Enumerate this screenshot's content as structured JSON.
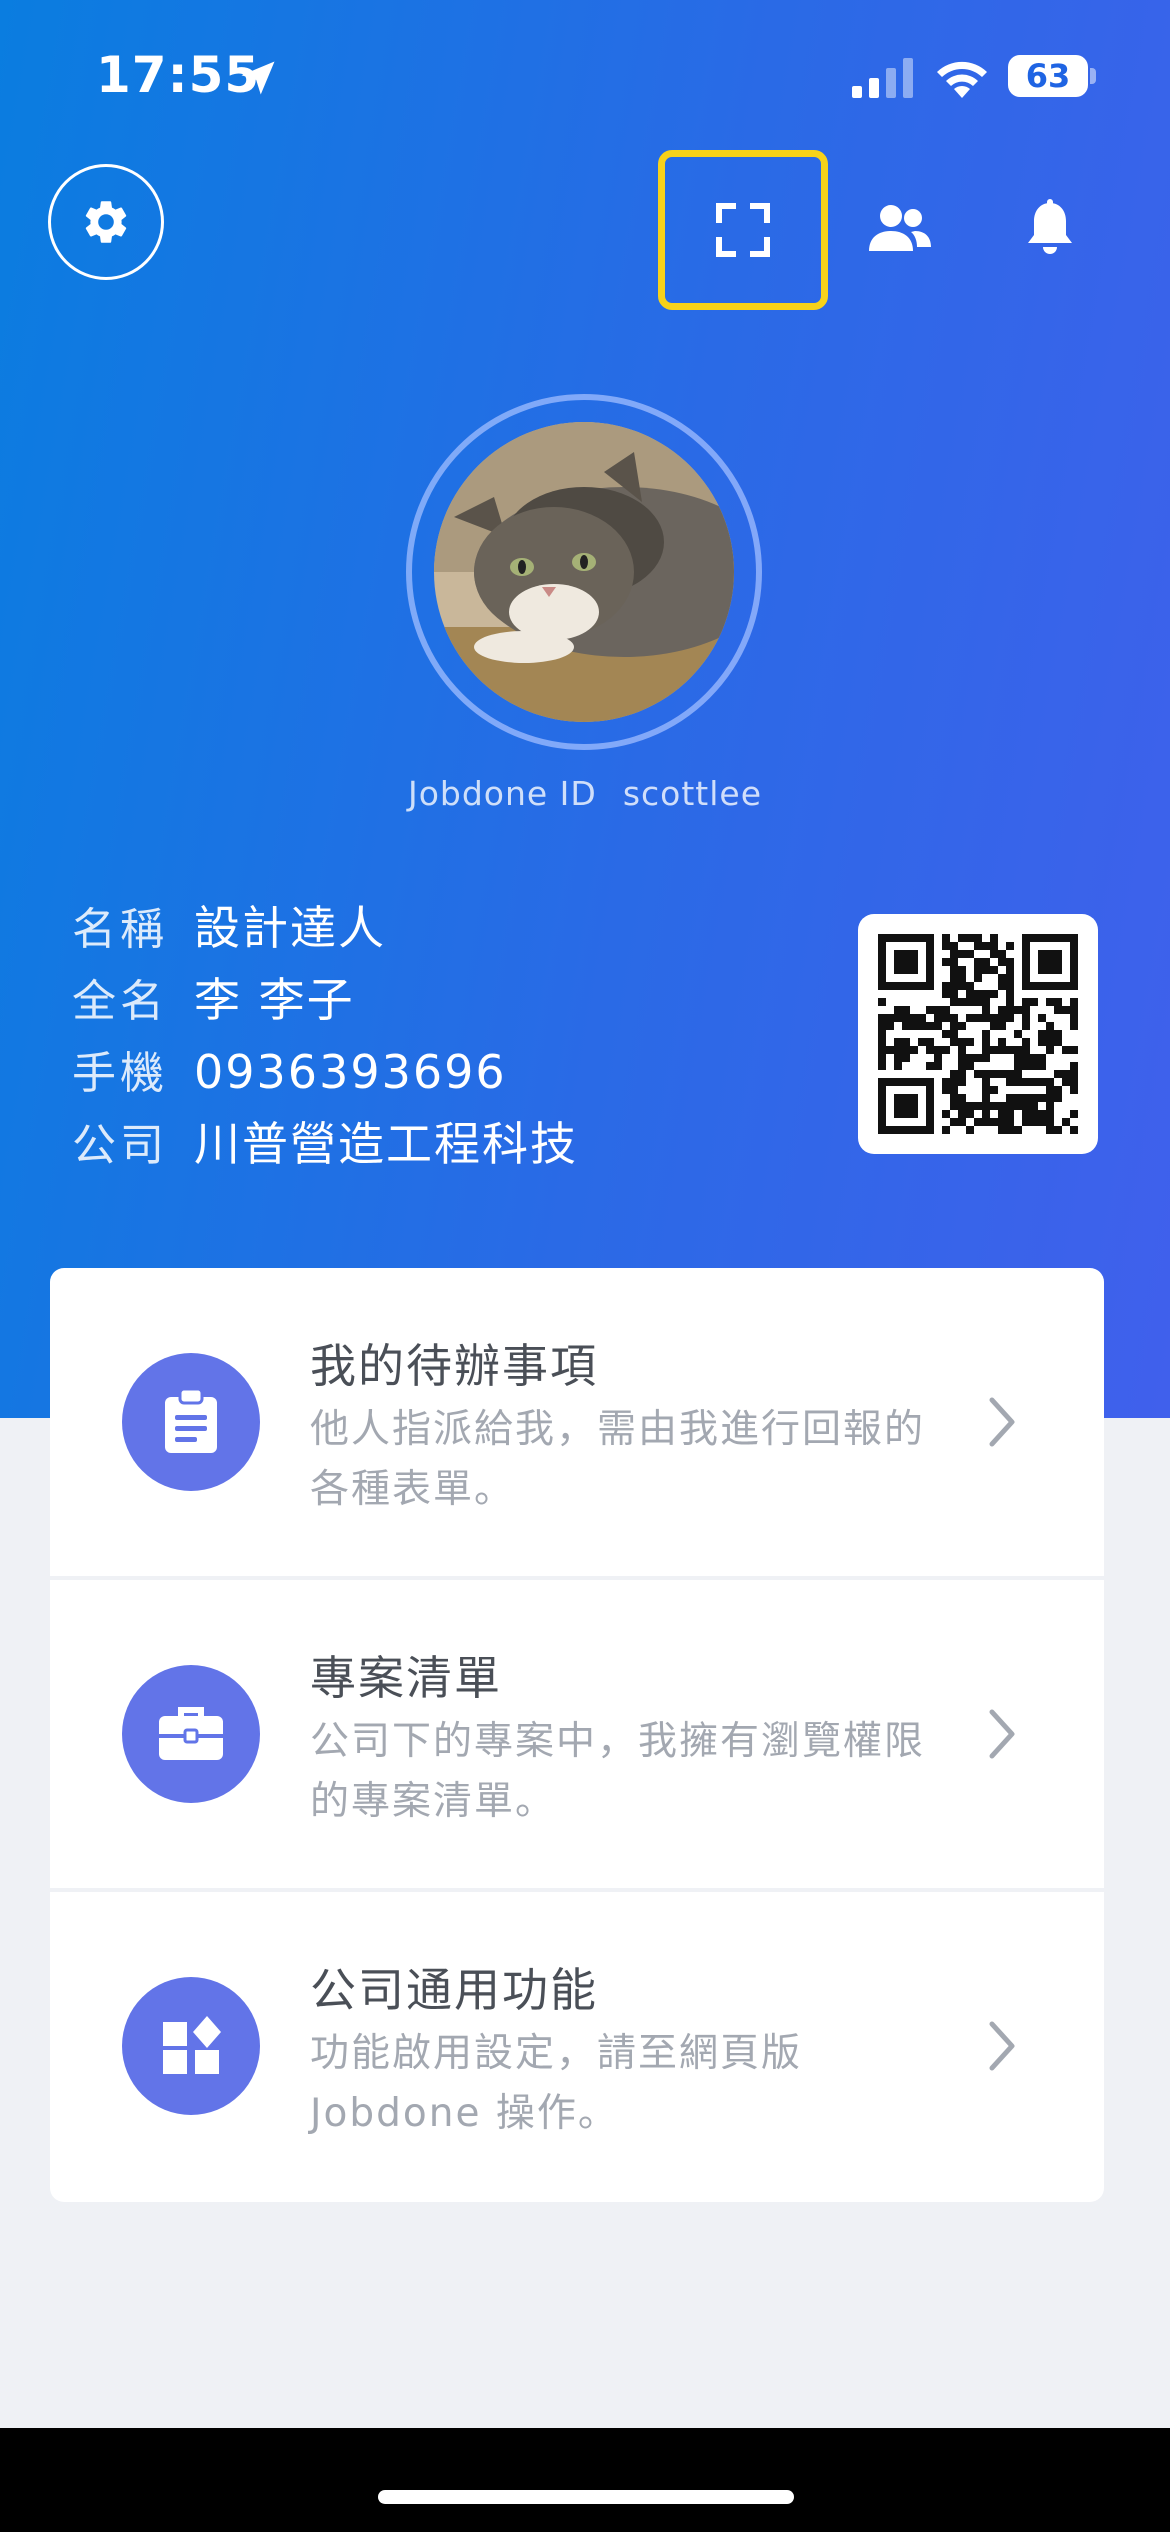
{
  "status_bar": {
    "time": "17:55",
    "battery": "63",
    "icons": [
      "location-arrow-icon",
      "signal-icon",
      "wifi-icon",
      "battery-icon"
    ]
  },
  "header": {
    "icons": [
      "gear-icon",
      "scan-frame-icon",
      "contacts-icon",
      "bell-icon"
    ],
    "highlight_color": "#f7d21a"
  },
  "profile": {
    "jobdone_id_label": "Jobdone ID",
    "jobdone_id": "scottlee",
    "fields": [
      {
        "label": "名稱",
        "value": "設計達人"
      },
      {
        "label": "全名",
        "value": "李 李子"
      },
      {
        "label": "手機",
        "value": "0936393696"
      },
      {
        "label": "公司",
        "value": "川普營造工程科技"
      }
    ]
  },
  "menu": [
    {
      "title": "我的待辦事項",
      "desc": "他人指派給我，需由我進行回報的各種表單。",
      "icon": "clipboard-icon"
    },
    {
      "title": "專案清單",
      "desc": "公司下的專案中，我擁有瀏覽權限的專案清單。",
      "icon": "briefcase-icon"
    },
    {
      "title": "公司通用功能",
      "desc": "功能啟用設定，請至網頁版 Jobdone 操作。",
      "icon": "widgets-icon"
    }
  ],
  "colors": {
    "gradient_start": "#0a7de0",
    "gradient_end": "#4060ec",
    "card_icon_bg": "#6274e8"
  }
}
